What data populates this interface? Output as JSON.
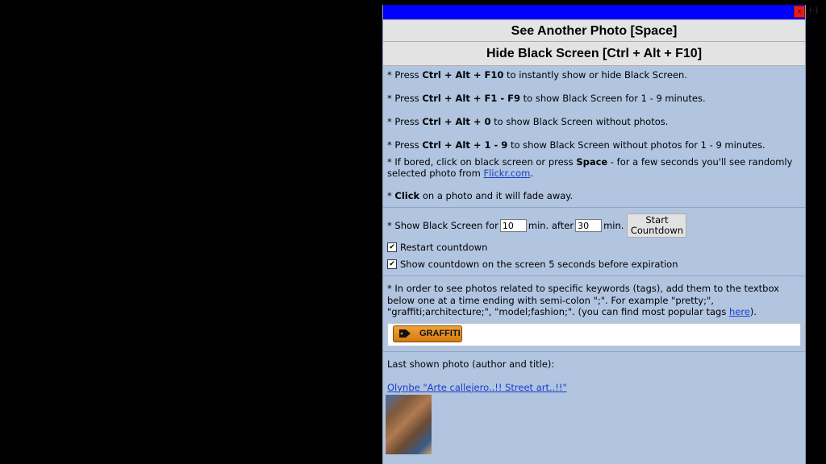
{
  "panel": {
    "close_label": "x",
    "outside_label": "(-)"
  },
  "buttons": {
    "another_photo": "See Another Photo [Space]",
    "hide_screen": "Hide Black Screen [Ctrl + Alt + F10]"
  },
  "help": {
    "line1": {
      "pre": "* Press ",
      "bold": "Ctrl + Alt + F10",
      "post": " to instantly show or hide Black Screen."
    },
    "line2": {
      "pre": "* Press ",
      "bold": "Ctrl + Alt + F1 - F9",
      "post": " to show Black Screen for 1 - 9 minutes."
    },
    "line3": {
      "pre": "* Press ",
      "bold": "Ctrl + Alt + 0",
      "post": " to show Black Screen without photos."
    },
    "line4": {
      "pre": "* Press ",
      "bold": "Ctrl + Alt + 1 - 9",
      "post": " to show Black Screen without photos for 1 - 9 minutes."
    },
    "line5": {
      "pre": "* If bored, click on black screen or press ",
      "bold": "Space",
      "post": " - for a few seconds you'll see randomly selected photo from ",
      "link": "Flickr.com",
      "end": "."
    },
    "line6": {
      "pre": "* ",
      "bold": "Click",
      "post": " on a photo and it will fade away."
    }
  },
  "settings": {
    "show_label": "* Show Black Screen for",
    "show_minutes": "10",
    "after_label": "min. after",
    "after_minutes": "30",
    "min_label": "min.",
    "start_button": "Start Countdown",
    "restart_label": "Restart countdown",
    "restart_checked": true,
    "show_countdown_label": "Show countdown on the screen 5 seconds before expiration",
    "show_countdown_checked": true
  },
  "tags": {
    "instructions": "* In order to see photos related to specific keywords (tags), add them to the textbox below one at a time ending with semi-colon \";\". For example \"pretty;\", \"graffiti;architecture;\", \"model;fashion;\". (you can find most popular tags ",
    "here_link": "here",
    "instructions_end": ").",
    "tag_label": "GRAFFITI"
  },
  "last_photo": {
    "label": "Last shown photo (author and title):",
    "link": "Olynbe \"Arte callejero..!!  Street art..!!\""
  },
  "colors": {
    "panel_bg": "#b1c5e1",
    "titlebar": "#0000ff",
    "tag_orange": "#e8901f"
  }
}
